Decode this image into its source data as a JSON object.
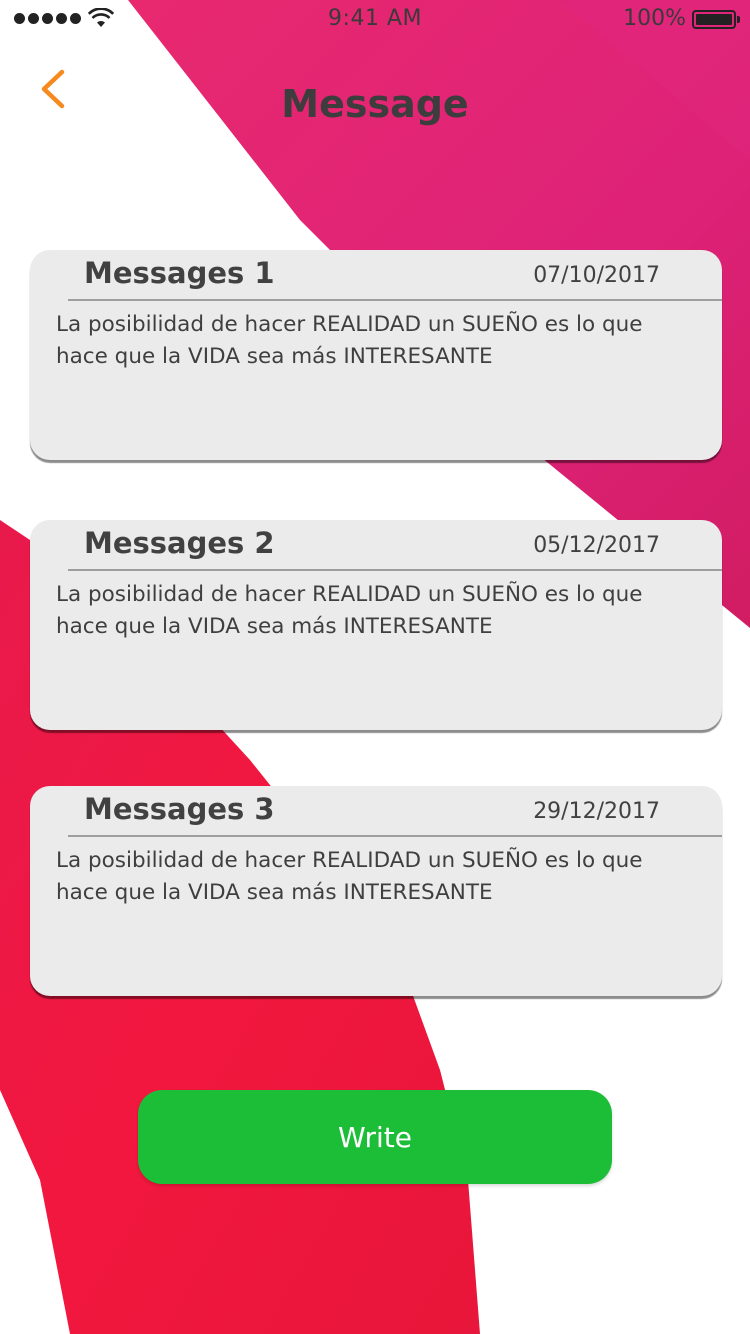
{
  "status_bar": {
    "time": "9:41 AM",
    "battery": "100%"
  },
  "header": {
    "title": "Message",
    "back_icon": "chevron-left-icon",
    "back_color": "#f68a1e"
  },
  "messages": [
    {
      "title": "Messages 1",
      "date": "07/10/2017",
      "body": "La posibilidad de hacer REALIDAD un SUEÑO es lo que hace que la VIDA sea más INTERESANTE"
    },
    {
      "title": "Messages 2",
      "date": "05/12/2017",
      "body": "La posibilidad de hacer REALIDAD un SUEÑO es lo que hace que la VIDA sea más INTERESANTE"
    },
    {
      "title": "Messages 3",
      "date": "29/12/2017",
      "body": "La posibilidad de hacer REALIDAD un SUEÑO es lo que hace que la VIDA sea más INTERESANTE"
    }
  ],
  "write_button": {
    "label": "Write",
    "color": "#1dbe37"
  },
  "colors": {
    "background_pink": "#e0237a",
    "background_red": "#f0163f",
    "card": "#ebebeb"
  }
}
